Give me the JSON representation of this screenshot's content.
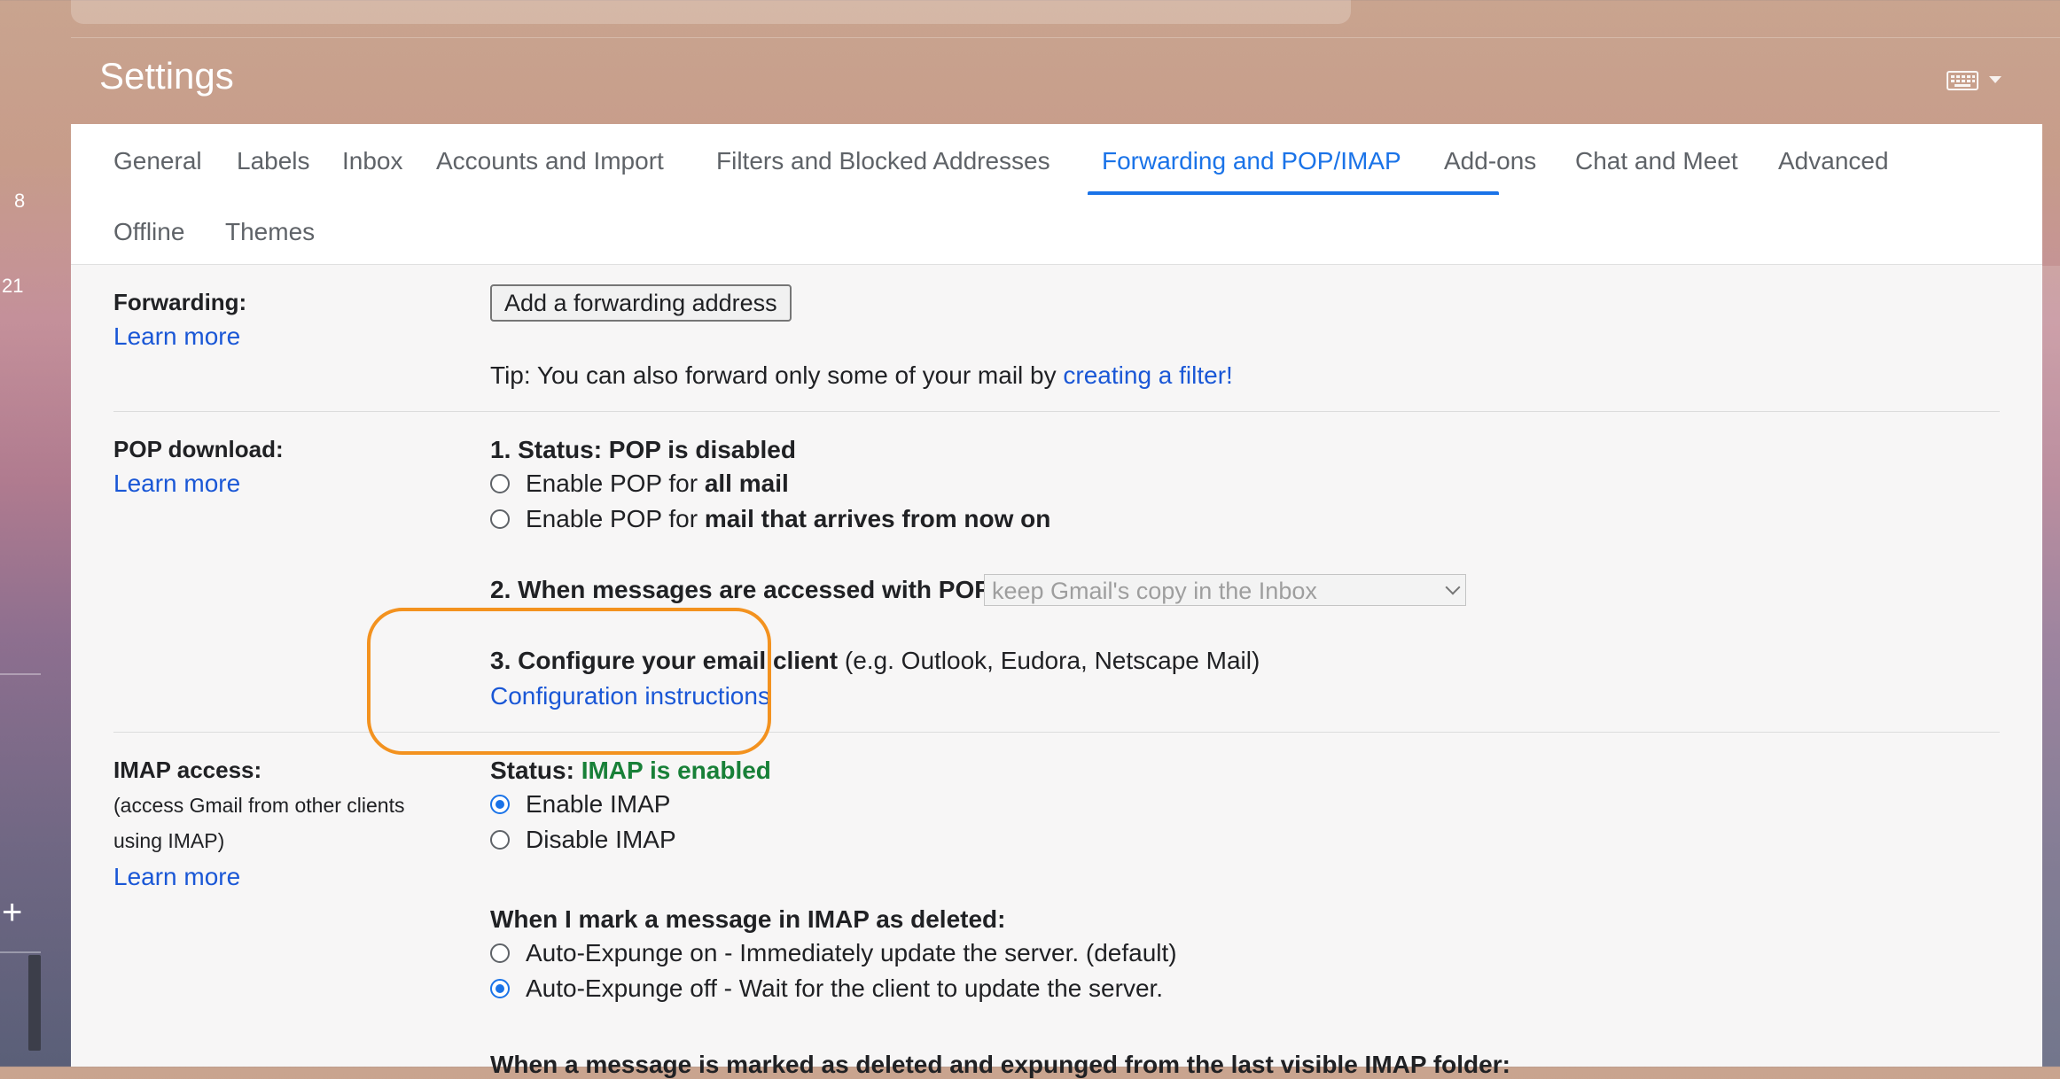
{
  "left_strip": {
    "num1": "8",
    "num2": "21",
    "plus": "+"
  },
  "header": {
    "title": "Settings"
  },
  "tabs": [
    {
      "label": "General"
    },
    {
      "label": "Labels"
    },
    {
      "label": "Inbox"
    },
    {
      "label": "Accounts and Import"
    },
    {
      "label": "Filters and Blocked Addresses"
    },
    {
      "label": "Forwarding and POP/IMAP"
    },
    {
      "label": "Add-ons"
    },
    {
      "label": "Chat and Meet"
    },
    {
      "label": "Advanced"
    },
    {
      "label": "Offline"
    },
    {
      "label": "Themes"
    }
  ],
  "active_tab": "Forwarding and POP/IMAP",
  "forwarding": {
    "label": "Forwarding:",
    "learn_more": "Learn more",
    "button": "Add a forwarding address",
    "tip_text": "Tip: You can also forward only some of your mail by ",
    "tip_link": "creating a filter!"
  },
  "pop": {
    "label": "POP download:",
    "learn_more": "Learn more",
    "status": "1. Status: POP is disabled",
    "opt1_prefix": "Enable POP for ",
    "opt1_bold": "all mail",
    "opt2_prefix": "Enable POP for ",
    "opt2_bold": "mail that arrives from now on",
    "when_accessed": "2. When messages are accessed with POP",
    "select_value": "keep Gmail's copy in the Inbox",
    "configure_bold": "3. Configure your email client",
    "configure_rest": " (e.g. Outlook, Eudora, Netscape Mail)",
    "config_link": "Configuration instructions"
  },
  "imap": {
    "label": "IMAP access:",
    "desc1": "(access Gmail from other clients",
    "desc2": "using IMAP)",
    "learn_more": "Learn more",
    "status_prefix": "Status: ",
    "status_value": "IMAP is enabled",
    "enable": "Enable IMAP",
    "disable": "Disable IMAP",
    "enabled": true,
    "delete_heading": "When I mark a message in IMAP as deleted:",
    "expunge_on": "Auto-Expunge on - Immediately update the server. (default)",
    "expunge_off": "Auto-Expunge off - Wait for the client to update the server.",
    "expunge_off_selected": true,
    "next_heading": "When a message is marked as deleted and expunged from the last visible IMAP folder:"
  },
  "colors": {
    "accent": "#1a73e8",
    "link": "#1a57d6",
    "status_green": "#188038",
    "highlight": "#f3921f"
  }
}
